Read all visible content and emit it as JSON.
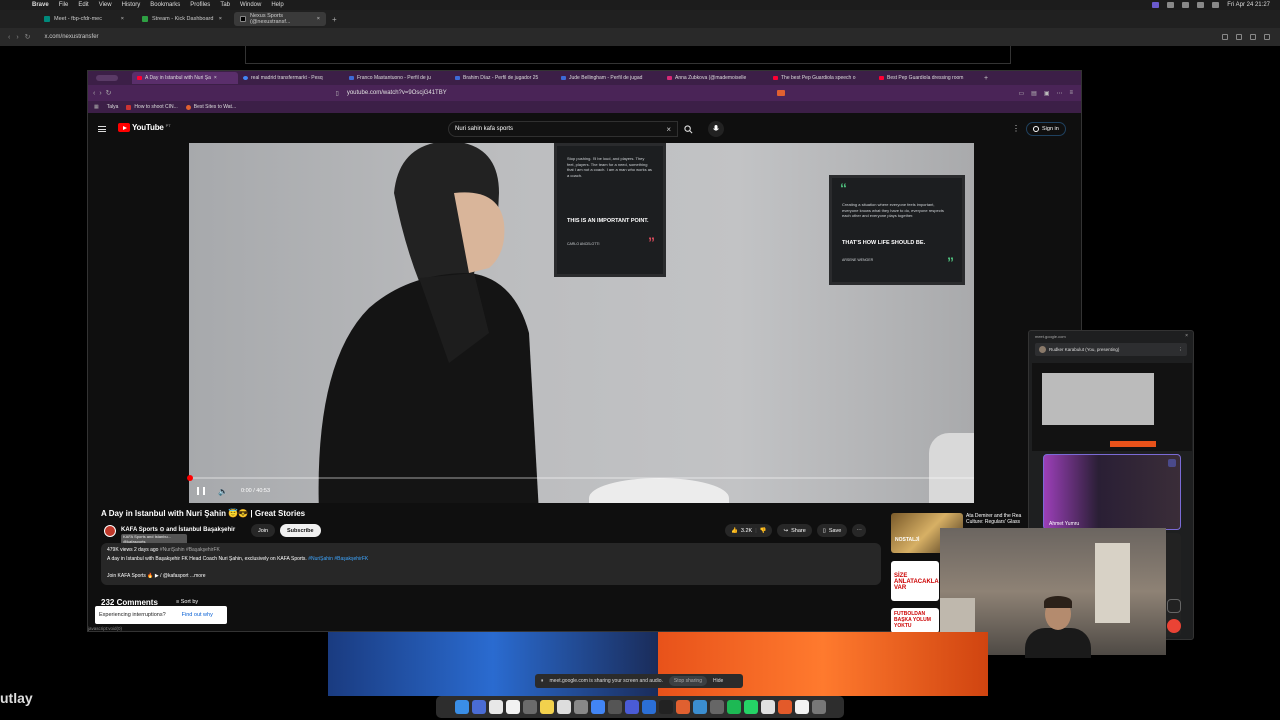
{
  "menubar": {
    "app": "Brave",
    "items": [
      "File",
      "Edit",
      "View",
      "History",
      "Bookmarks",
      "Profiles",
      "Tab",
      "Window",
      "Help"
    ],
    "clock": "Fri Apr 24  21:27"
  },
  "outer_browser": {
    "tabs": [
      {
        "label": "Meet - fbp-cfdr-mec"
      },
      {
        "label": "Stream - Kick Dashboard"
      },
      {
        "label": "Nexus Sports (@nexustransf..."
      }
    ],
    "url": "x.com/nexustransfer"
  },
  "inner_browser": {
    "tabs": [
      {
        "label": "A Day in Istanbul with Nuri Şa"
      },
      {
        "label": "real madrid transfermarkt - Pesq"
      },
      {
        "label": "Franco Mastantuono - Perfil de ju"
      },
      {
        "label": "Brahim Díaz - Perfil de jugador 25"
      },
      {
        "label": "Jude Bellingham - Perfil de jugad"
      },
      {
        "label": "Anna Zubkova (@mademoiselle"
      },
      {
        "label": "The best Pep Guardiola speech o"
      },
      {
        "label": "Best Pep Guardiola dressing room"
      }
    ],
    "url": "youtube.com/watch?v=9OscjG41TBY",
    "bookmarks": [
      {
        "label": "Talya"
      },
      {
        "label": "How to shoot CIN..."
      },
      {
        "label": "Best Sites to Wat..."
      }
    ]
  },
  "youtube": {
    "logo": "YouTube",
    "logo_country": "PT",
    "search_value": "Nuri sahin kafa sports",
    "sign_in": "Sign in",
    "player": {
      "time": "0:00 / 40:53",
      "progress": 0.0,
      "quote1_small": "Stop pushing. I'll be loud, and players. They feel, players. The team for a need, something that I am not a coach. I am a man who works as a coach.",
      "quote1_big": "THIS IS AN IMPORTANT POINT.",
      "quote1_author": "CARLO ANCELOTTI",
      "quote2_small": "Creating a situation where everyone feels important, everyone knows what they have to do, everyone respects each other and everyone plays together.",
      "quote2_big": "THAT'S HOW LIFE SHOULD BE.",
      "quote2_author": "ARSENE WENGER"
    },
    "video_title": "A Day in Istanbul with Nuri Şahin 😇😎 | Great Stories",
    "channel": "KAFA Sports ⊙ and İstanbul Başakşehir",
    "channel_tooltip": "KAFA Sports and İstanbu... @kafasports",
    "join": "Join",
    "subscribe": "Subscribe",
    "actions": {
      "likes": "3.2K",
      "share": "Share",
      "save": "Save"
    },
    "description": {
      "stats": "479K views  2 days ago",
      "stats_tags": "#NuriŞahin #BaşakşehirFK",
      "line2": "A day in Istanbul with Başakşehir FK Head Coach Nuri Şahin, exclusively on KAFA Sports.",
      "line2_tags": "#NuriŞahin #BaşakşehirFK",
      "line3": "Join KAFA Sports 🔥 ▶ / @kafasport  ...more"
    },
    "comments": "232 Comments",
    "sort_by": "Sort by",
    "interruption": {
      "text": "Experiencing interruptions?",
      "link": "Find out why"
    },
    "status_url": "javascript:void(0)",
    "related": [
      {
        "title": "Ata Demirer and the Rea Culture: Regulars' Glass",
        "thumb_text": "NOSTALJİ"
      },
      {
        "title": "",
        "thumb_text": "SİZE ANLATACAKLARIM VAR"
      },
      {
        "title": "",
        "thumb_text": "FUTBOLDAN BAŞKA YOLUM YOKTU"
      }
    ]
  },
  "meet": {
    "url": "meet.google.com",
    "presenting": "Rudker Karabulut (You, presenting)",
    "participant": "Ahmet Yumru",
    "share_banner": "meet.google.com is sharing your screen and audio.",
    "stop_sharing": "Stop sharing",
    "hide": "Hide"
  },
  "background_text": "utlay",
  "colors": {
    "youtube_red": "#ff0000",
    "inner_tabbar": "#3c1f47",
    "meet_hangup": "#ea4335",
    "link_blue": "#3ea6ff"
  }
}
